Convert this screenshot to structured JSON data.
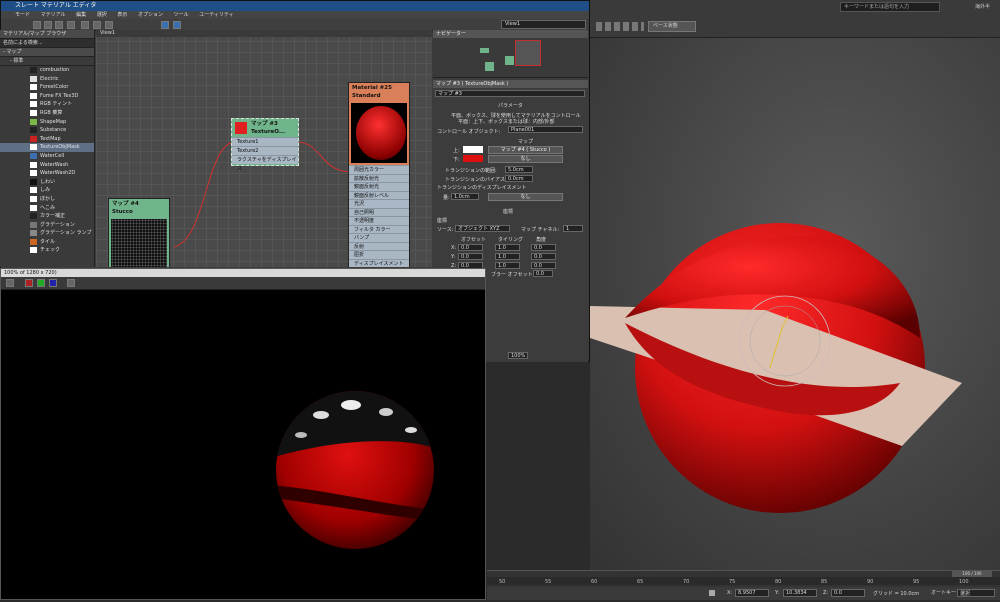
{
  "slate": {
    "title": "スレート マテリアル エディタ",
    "menu": [
      "モード",
      "マテリアル",
      "編集",
      "選択",
      "表示",
      "オプション",
      "ツール",
      "ユーティリティ"
    ],
    "view_dropdown": "View1"
  },
  "browser": {
    "title": "マテリアル/マップ ブラウザ",
    "search": "名前による検索...",
    "group_maps": "- マップ",
    "group_standard": "- 標準",
    "items": [
      {
        "label": "combustion",
        "color": "#222222"
      },
      {
        "label": "Electric",
        "color": "#e0e0e0"
      },
      {
        "label": "ForestColor",
        "color": "#ffffff"
      },
      {
        "label": "Fume FX Tex3D",
        "color": "#ffffff"
      },
      {
        "label": "RGB ティント",
        "color": "#ffffff"
      },
      {
        "label": "RGB 乗算",
        "color": "#ffffff"
      },
      {
        "label": "ShapeMap",
        "color": "#7ab648"
      },
      {
        "label": "Substance",
        "color": "#222222"
      },
      {
        "label": "TextMap",
        "color": "#cc2222"
      },
      {
        "label": "TextureObjMask",
        "color": "#ffffff"
      },
      {
        "label": "WaterCell",
        "color": "#3d6fae"
      },
      {
        "label": "WaterWash",
        "color": "#ffffff"
      },
      {
        "label": "WaterWash2D",
        "color": "#ffffff"
      },
      {
        "label": "しわい",
        "color": "#111111"
      },
      {
        "label": "しみ",
        "color": "#ffffff"
      },
      {
        "label": "ぼかし",
        "color": "#ffffff"
      },
      {
        "label": "へこみ",
        "color": "#ffffff"
      },
      {
        "label": "カラー補正",
        "color": "#222222"
      },
      {
        "label": "グラデーション",
        "color": "#777777"
      },
      {
        "label": "グラデーション ランプ",
        "color": "#888888"
      },
      {
        "label": "タイル",
        "color": "#cc6622"
      },
      {
        "label": "チェック",
        "color": "#ffffff"
      }
    ]
  },
  "nodeview": {
    "tab": "View1",
    "map3": {
      "title": "マップ #3",
      "subtitle": "TextureO...",
      "slots": [
        "Texture1",
        "Texture2",
        "ラクスチャをディスプレイス"
      ]
    },
    "map4": {
      "title": "マップ #4",
      "subtitle": "Stucco"
    },
    "material": {
      "title": "Material #25",
      "subtitle": "Standard",
      "slots": [
        "周囲光カラー",
        "拡散反射光",
        "鏡面反射光",
        "鏡面反射レベル",
        "光沢",
        "自己照明",
        "不透明度",
        "フィルタ カラー",
        "バンプ",
        "反射",
        "屈折",
        "ディスプレイスメント"
      ]
    }
  },
  "navigator": {
    "title": "ナビゲーター"
  },
  "params": {
    "title": "マップ #3 ( TextureObjMask )",
    "name": "マップ #3",
    "section1": "パラメータ",
    "desc_line1": "平面、ボックス、球を使用してマテリアルをコントロール",
    "desc_line2": "平面：上下、ボックスまたは球：内部/外部",
    "control_label": "コントロール オブジェクト:",
    "control_value": "Plane001",
    "map_label": "マップ",
    "top_label": "上:",
    "top_map": "マップ #4 ( Stucco )",
    "bottom_label": "下:",
    "bottom_map": "なし",
    "transition_range_label": "トランジションの範囲:",
    "transition_range_value": "5.0cm",
    "transition_bias_label": "トランジションのバイアス:",
    "transition_bias_value": "0.0cm",
    "transition_disp_label": "トランジションのディスプレイスメント",
    "amount_label": "量:",
    "amount_value": "1.0cm",
    "amount_map": "なし",
    "section2": "座標",
    "coords_label": "座標",
    "source_label": "ソース:",
    "source_value": "オブジェクト XYZ",
    "map_channel_label": "マップ チャネル:",
    "map_channel_value": "1",
    "offset_label": "オフセット",
    "tiling_label": "タイリング",
    "angle_label": "角度",
    "axis_x": "X:",
    "axis_y": "Y:",
    "axis_z": "Z:",
    "offset_vals": [
      "0.0",
      "0.0",
      "0.0"
    ],
    "tiling_vals": [
      "1.0",
      "1.0",
      "1.0"
    ],
    "angle_vals": [
      "0.0",
      "0.0",
      "0.0"
    ],
    "blur_offset_label": "ブラー オフセット:",
    "blur_offset_value": "0.0",
    "zoom": "100%"
  },
  "render": {
    "title": "100% of 1280 x 720)"
  },
  "max": {
    "search_placeholder": "キーワードまたは語句を入力",
    "user": "海外半",
    "view_label": "ベース状態",
    "timeline_counter": "100 / 100",
    "ticks": [
      "50",
      "55",
      "60",
      "65",
      "70",
      "75",
      "80",
      "85",
      "90",
      "95",
      "100"
    ],
    "x_label": "X:",
    "x_value": "8.9507",
    "y_label": "Y:",
    "y_value": "10.3834",
    "z_label": "Z:",
    "z_value": "0.0",
    "grid_label": "グリッド = 10.0cm",
    "auto_key": "オートキー",
    "selection": "選択"
  }
}
